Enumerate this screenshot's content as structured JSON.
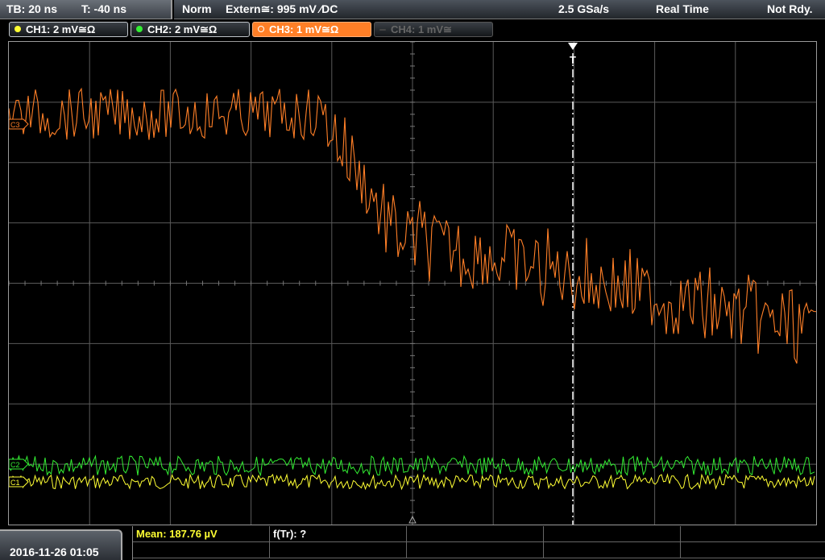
{
  "header": {
    "timebase": "TB: 20 ns",
    "trigger_time": "T: -40 ns",
    "trigger_mode": "Norm",
    "trigger_source": "Extern≅: 995 mV ∕DC",
    "sample_rate": "2.5 GSa/s",
    "acq_mode": "Real Time",
    "status": "Not Rdy."
  },
  "channels": [
    {
      "label": "CH1: 2 mV≅Ω",
      "color": "#ffff33",
      "state": "on"
    },
    {
      "label": "CH2: 2 mV≅Ω",
      "color": "#33ee33",
      "state": "on"
    },
    {
      "label": "CH3: 1 mV≅Ω",
      "color": "#ff7f27",
      "state": "active"
    },
    {
      "label": "CH4: 1 mV≅",
      "color": "#555555",
      "state": "off"
    }
  ],
  "markers": {
    "ch3": "C3",
    "ch2": "C2",
    "ch1": "C1",
    "trigger": "T"
  },
  "footer": {
    "datetime": "2016-11-26 01:05",
    "mean": "Mean: 187.76 µV",
    "rise": "f(Tr): ?"
  },
  "colors": {
    "ch1": "#ffff33",
    "ch2": "#33ee33",
    "ch3": "#ff7f27",
    "grid": "#5a5a5a",
    "cursor": "#ffffff"
  }
}
